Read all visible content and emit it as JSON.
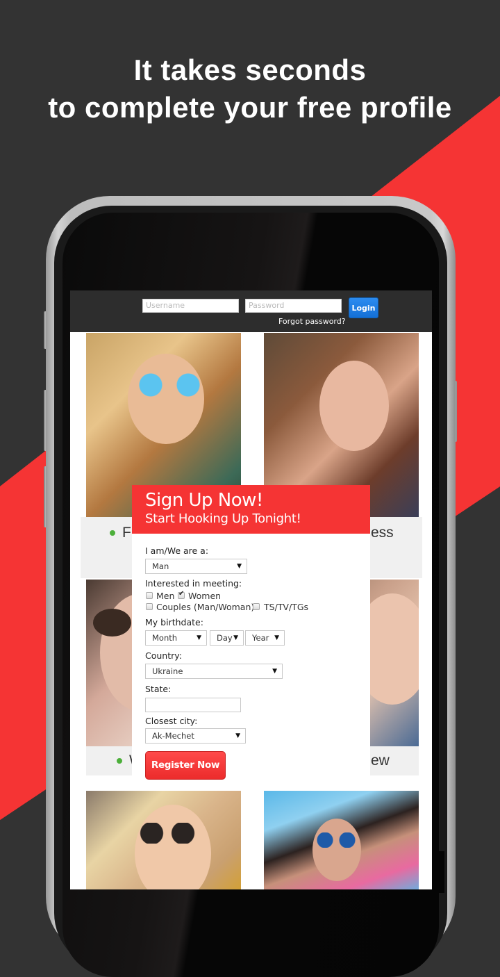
{
  "promo": {
    "headline_line1": "It takes seconds",
    "headline_line2": "to complete your free profile",
    "accent_color": "#f53434",
    "background_color": "#333333"
  },
  "login_bar": {
    "username_placeholder": "Username",
    "password_placeholder": "Password",
    "login_label": "Login",
    "forgot_password_label": "Forgot password?"
  },
  "feature_captions": [
    {
      "visible_left": "F",
      "visible_right": "ess"
    },
    {
      "visible_left": "W",
      "visible_right": "ew"
    }
  ],
  "signup": {
    "title": "Sign Up Now!",
    "subtitle": "Start Hooking Up Tonight!",
    "iam_label": "I am/We are a:",
    "iam_value": "Man",
    "interested_label": "Interested in meeting:",
    "interests": [
      {
        "label": "Men",
        "checked": false
      },
      {
        "label": "Women",
        "checked": true
      },
      {
        "label": "Couples (Man/Woman)",
        "checked": false
      },
      {
        "label": "TS/TV/TGs",
        "checked": false
      }
    ],
    "birthdate_label": "My birthdate:",
    "month_value": "Month",
    "day_value": "Day",
    "year_value": "Year",
    "country_label": "Country:",
    "country_value": "Ukraine",
    "state_label": "State:",
    "state_value": "",
    "city_label": "Closest city:",
    "city_value": "Ak-Mechet",
    "register_label": "Register Now",
    "dropdown_arrow": "▼"
  }
}
